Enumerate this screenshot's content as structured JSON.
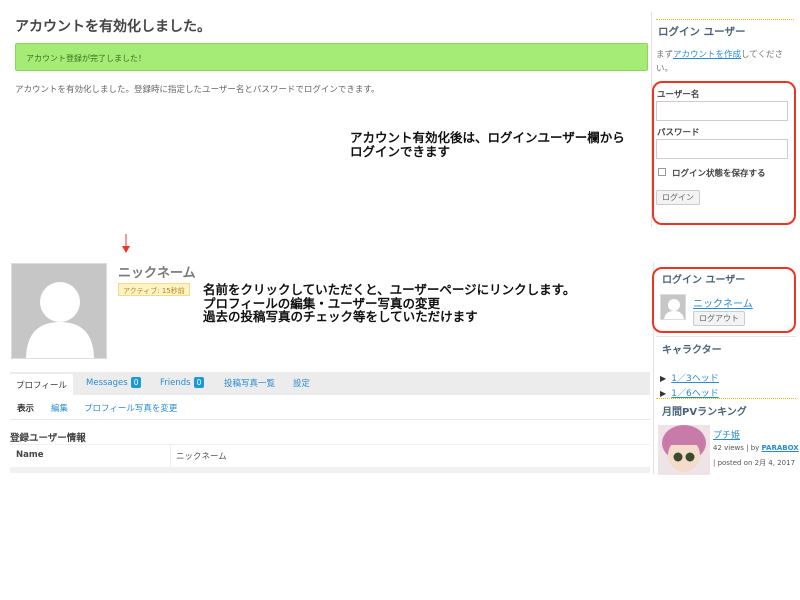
{
  "activation": {
    "title": "アカウントを有効化しました。",
    "alert": "アカウント登録が完了しました！",
    "message": "アカウントを有効化しました。登録時に指定したユーザー名とパスワードでログインできます。"
  },
  "annotations": {
    "login_note_line1": "アカウント有効化後は、ログインユーザー欄から",
    "login_note_line2": "ログインできます",
    "profile_note_line1": "名前をクリックしていただくと、ユーザーページにリンクします。",
    "profile_note_line2": "プロフィールの編集・ユーザー写真の変更",
    "profile_note_line3": "過去の投稿写真のチェック等をしていただけます",
    "annotation_color": "#ee3322"
  },
  "login_widget": {
    "title": "ログイン ユーザー",
    "desc_prefix": "まず",
    "desc_link": "アカウントを作成",
    "desc_suffix": "してください。",
    "username_label": "ユーザー名",
    "password_label": "パスワード",
    "remember_label": "ログイン状態を保存する",
    "login_button": "ログイン"
  },
  "logged_in_widget": {
    "title": "ログイン ユーザー",
    "user_name": "ニックネーム",
    "logout_button": "ログアウト"
  },
  "profile": {
    "nickname": "ニックネーム",
    "active_status": "アクティブ: 15秒前",
    "tabs": [
      {
        "label": "プロフィール"
      },
      {
        "label": "Messages",
        "badge": "0"
      },
      {
        "label": "Friends",
        "badge": "0"
      },
      {
        "label": "投稿写真一覧"
      },
      {
        "label": "設定"
      }
    ],
    "subtabs": [
      "表示",
      "編集",
      "プロフィール写真を変更"
    ],
    "section_title": "登録ユーザー情報",
    "fields": [
      {
        "key": "Name",
        "value": "ニックネーム"
      }
    ]
  },
  "character_widget": {
    "title": "キャラクター",
    "items": [
      "1／3ヘッド",
      "1／6ヘッド"
    ]
  },
  "ranking_widget": {
    "title": "月間PVランキング",
    "item_title": "プチ姫",
    "item_views": "42 views",
    "item_by": "| by",
    "item_author": "PARABOX",
    "item_posted": "| posted on 2月 4, 2017"
  },
  "colors": {
    "accent_link": "#2a8bd1",
    "alert_bg": "#a5ec77",
    "badge_bg": "#1b9ad6"
  }
}
